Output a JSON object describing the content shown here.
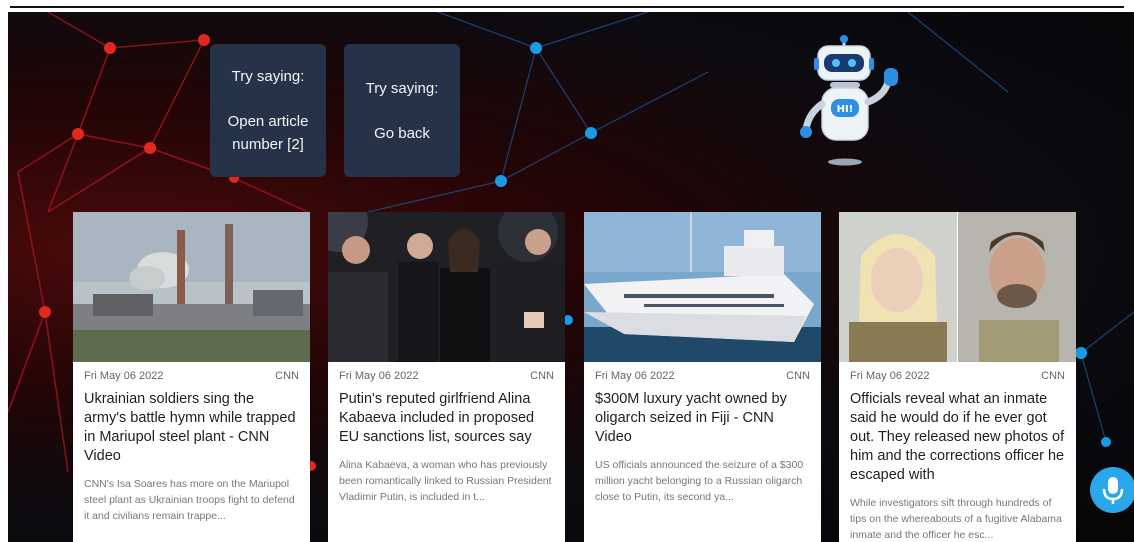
{
  "hints": [
    {
      "heading": "Try saying:",
      "command": "Open article number [2]"
    },
    {
      "heading": "Try saying:",
      "command": "Go back"
    }
  ],
  "robot": {
    "badge": "HI!"
  },
  "articles": [
    {
      "date": "Fri May 06 2022",
      "source": "CNN",
      "title": "Ukrainian soldiers sing the army's battle hymn while trapped in Mariupol steel plant - CNN Video",
      "description": "CNN's Isa Soares has more on the Mariupol steel plant as Ukrainian troops fight to defend it and civilians remain trappe..."
    },
    {
      "date": "Fri May 06 2022",
      "source": "CNN",
      "title": "Putin's reputed girlfriend Alina Kabaeva included in proposed EU sanctions list, sources say",
      "description": "Alina Kabaeva, a woman who has previously been romantically linked to Russian President Vladimir Putin, is included in t..."
    },
    {
      "date": "Fri May 06 2022",
      "source": "CNN",
      "title": "$300M luxury yacht owned by oligarch seized in Fiji - CNN Video",
      "description": "US officials announced the seizure of a $300 million yacht belonging to a Russian oligarch close to Putin, its second ya..."
    },
    {
      "date": "Fri May 06 2022",
      "source": "CNN",
      "title": "Officials reveal what an inmate said he would do if he ever got out. They released new photos of him and the corrections officer he escaped with",
      "description": "While investigators sift through hundreds of tips on the whereabouts of a fugitive Alabama inmate and the officer he esc..."
    }
  ],
  "colors": {
    "accent": "#2aa7ea",
    "card_bg": "#263247",
    "node_red": "#e0281e",
    "node_blue": "#1a9be8"
  },
  "icons": {
    "mic": "microphone-icon",
    "robot": "robot-icon"
  }
}
